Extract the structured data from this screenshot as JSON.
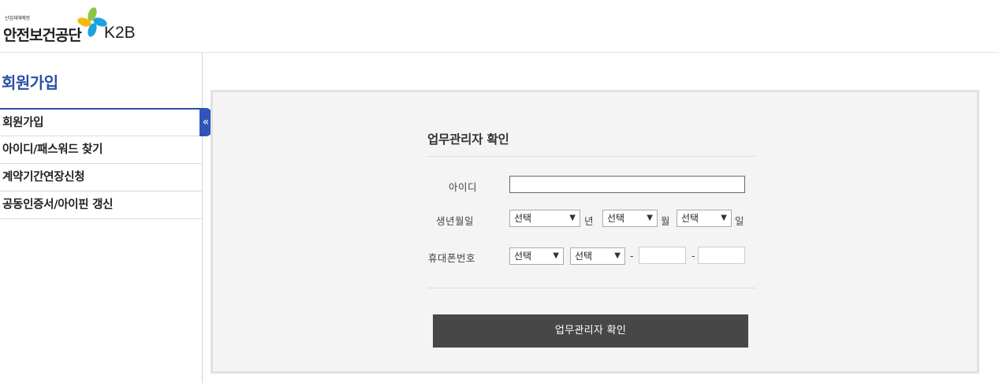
{
  "header": {
    "logo_small_text": "산업재해예방",
    "logo_org_name": "안전보건공단",
    "logo_k2b": "K2B"
  },
  "sidebar": {
    "title": "회원가입",
    "items": [
      {
        "label": "회원가입"
      },
      {
        "label": "아이디/패스워드 찾기"
      },
      {
        "label": "계약기간연장신청"
      },
      {
        "label": "공동인증서/아이핀 갱신"
      }
    ],
    "collapse_glyph": "«"
  },
  "form": {
    "title": "업무관리자 확인",
    "id_label": "아이디",
    "id_value": "",
    "birth_label": "생년월일",
    "birth_year_selected": "선택",
    "birth_year_unit": "년",
    "birth_month_selected": "선택",
    "birth_month_unit": "월",
    "birth_day_selected": "선택",
    "birth_day_unit": "일",
    "phone_label": "휴대폰번호",
    "phone_prefix_selected": "선택",
    "phone_carrier_selected": "선택",
    "phone_dash": "-",
    "phone_middle": "",
    "phone_last": "",
    "submit_label": "업무관리자 확인"
  },
  "colors": {
    "accent_blue": "#2b4fa6",
    "button_dark": "#474747",
    "panel_bg": "#f4f4f4"
  },
  "icons": {
    "collapse": "double-chevron-left-icon",
    "select_arrow": "chevron-down-icon"
  }
}
